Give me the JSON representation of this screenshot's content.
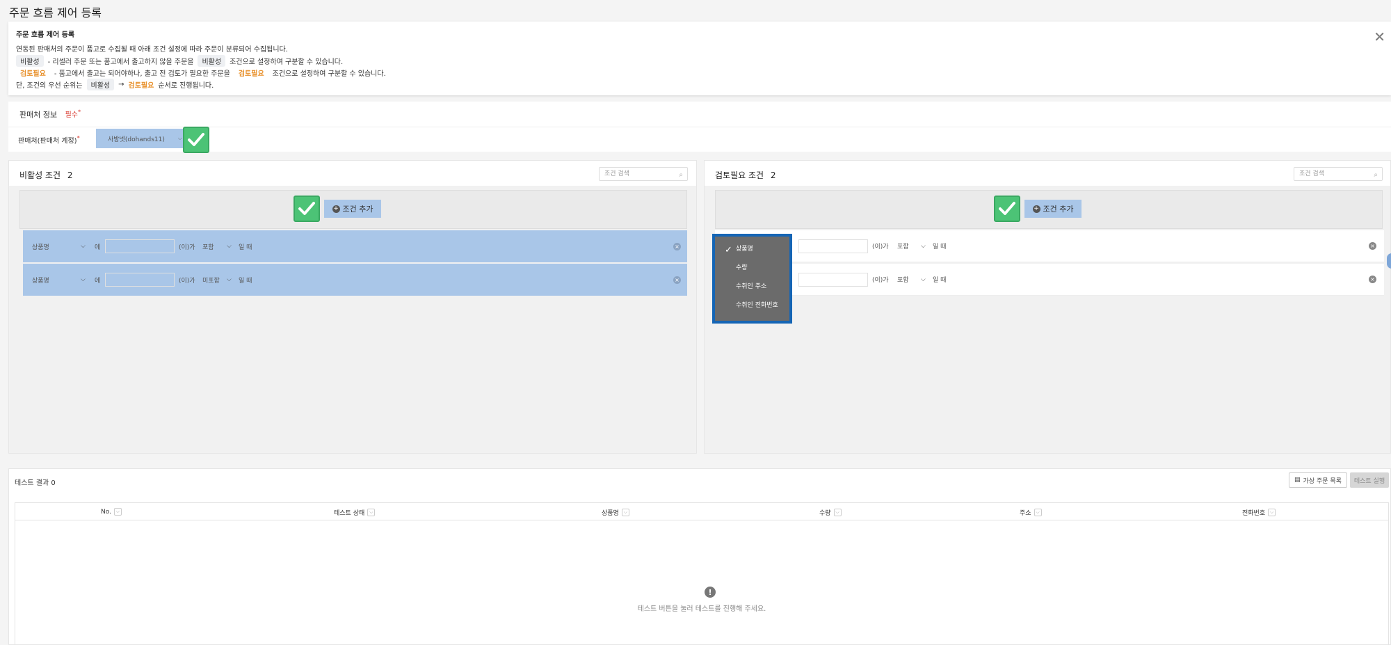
{
  "page_title": "주문 흐름 제어 등록",
  "notice": {
    "title": "주문 흐름 제어 등록",
    "line1": "연동된 판매처의 주문이 품고로 수집될 때 아래 조건 설정에 따라 주문이 분류되어 수집됩니다.",
    "line2_chip": "비활성",
    "line2_mid": "- 리셀러 주문 또는 품고에서 출고하지 않을 주문을",
    "line2_chip2": "비활성",
    "line2_end": "조건으로 설정하여 구분할 수 있습니다.",
    "line3_chip": "검토필요",
    "line3_mid": "- 품고에서 출고는 되어야하나, 출고 전 검토가 필요한 주문을",
    "line3_chip2": "검토필요",
    "line3_end": "조건으로 설정하여 구분할 수 있습니다.",
    "line4_start": "단, 조건의 우선 순위는",
    "line4_chip": "비활성",
    "line4_arrow": "→",
    "line4_chip2": "검토필요",
    "line4_end": "순서로 진행됩니다.",
    "close_icon": "close-icon"
  },
  "seller": {
    "header": "판매처 정보",
    "required": "필수",
    "required_mark": "*",
    "label": "판매처(판매처 계정)",
    "label_mark": "*",
    "selected": "사방넷(dohands11)"
  },
  "inactive": {
    "title": "비활성 조건",
    "count": "2",
    "search_placeholder": "조건 검색",
    "add_label": "조건 추가",
    "rows": [
      {
        "field": "상품명",
        "particle": "에",
        "value": "",
        "subject": "(이)가",
        "op": "포함",
        "tail": "일 때"
      },
      {
        "field": "상품명",
        "particle": "에",
        "value": "",
        "subject": "(이)가",
        "op": "미포함",
        "tail": "일 때"
      }
    ]
  },
  "review": {
    "title": "검토필요 조건",
    "count": "2",
    "search_placeholder": "조건 검색",
    "add_label": "조건 추가",
    "rows": [
      {
        "subject": "(이)가",
        "op": "포함",
        "tail": "일 때"
      },
      {
        "subject": "(이)가",
        "op": "포함",
        "tail": "일 때"
      }
    ]
  },
  "dropdown": {
    "options": [
      "상품명",
      "수량",
      "수취인 주소",
      "수취인 전화번호"
    ],
    "selected": "상품명"
  },
  "result": {
    "title": "테스트 결과",
    "count": "0",
    "virtual_orders_label": "가상 주문 목록",
    "run_label": "테스트 실행",
    "columns": [
      "No.",
      "테스트 상태",
      "상품명",
      "수량",
      "주소",
      "전화번호"
    ],
    "empty_icon": "!",
    "empty_text": "테스트 버튼을 눌러 테스트를 진행해 주세요."
  },
  "colors": {
    "selection": "#a9c6e8",
    "check_green": "#4cc376",
    "dropdown_border": "#1565b5",
    "orange": "#e8912c",
    "required_red": "#d9362b"
  }
}
